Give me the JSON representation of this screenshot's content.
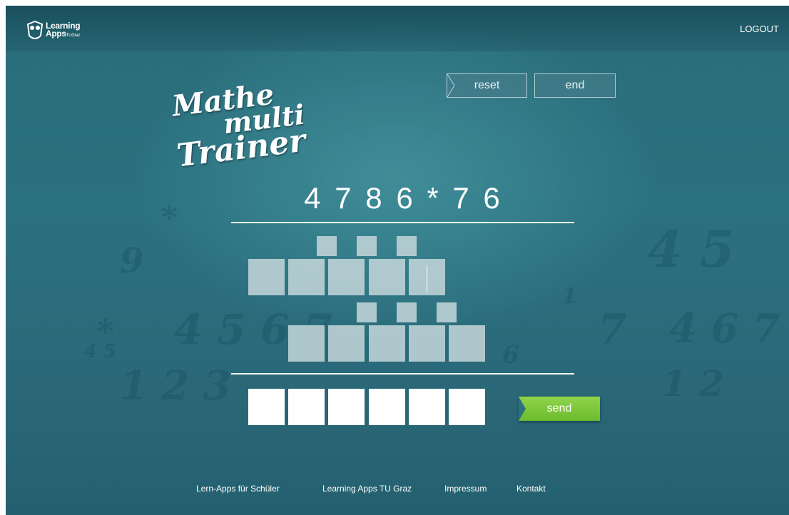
{
  "header": {
    "logo_line1": "Learning",
    "logo_line2": "Apps",
    "logo_small": "TUGraz",
    "logout_label": "LOGOUT"
  },
  "title": {
    "line1": "Mathe",
    "line2": "multi",
    "line3": "Trainer"
  },
  "controls": {
    "reset_label": "reset",
    "end_label": "end"
  },
  "problem": {
    "expression": "4 7 8 6 * 7 6"
  },
  "rows": {
    "partial1_cells": 5,
    "partial1_carry_cells": 3,
    "partial2_cells": 5,
    "partial2_carry_cells": 3,
    "answer_cells": 6
  },
  "send_label": "send",
  "footer": {
    "links": [
      "Lern-Apps für Schüler",
      "Learning Apps TU Graz",
      "Impressum",
      "Kontakt"
    ]
  },
  "colors": {
    "background": "#2c7180",
    "cell": "#bcd2d6",
    "send": "#7cc63a"
  }
}
